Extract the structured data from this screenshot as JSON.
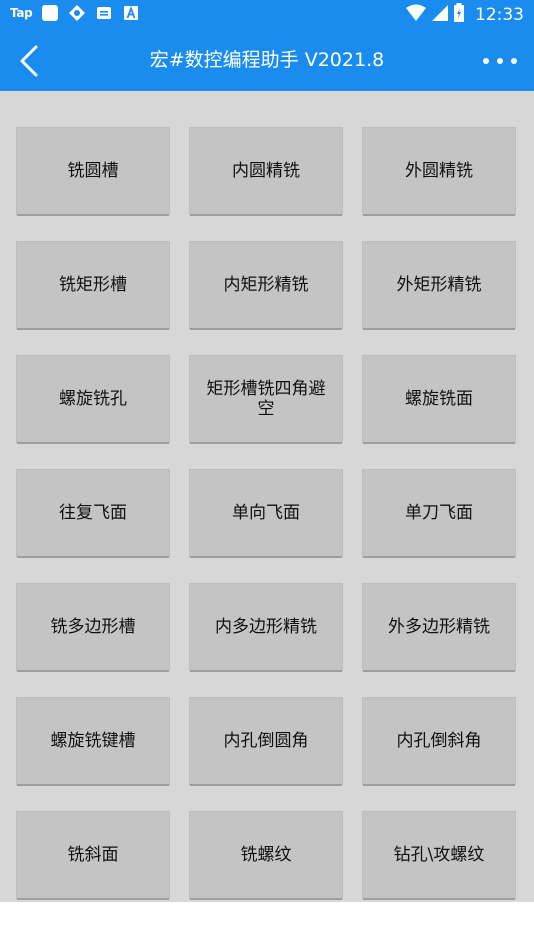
{
  "status_bar": {
    "tap_label": "Tap",
    "time": "12:33",
    "color": "#1a8cf0"
  },
  "app_bar": {
    "title": "宏#数控编程助手 V2021.8",
    "back_icon": "chevron-left-icon",
    "more_icon": "more-horizontal-icon"
  },
  "tools": [
    "铣圆槽",
    "内圆精铣",
    "外圆精铣",
    "铣矩形槽",
    "内矩形精铣",
    "外矩形精铣",
    "螺旋铣孔",
    "矩形槽铣四角避空",
    "螺旋铣面",
    "往复飞面",
    "单向飞面",
    "单刀飞面",
    "铣多边形槽",
    "内多边形精铣",
    "外多边形精铣",
    "螺旋铣键槽",
    "内孔倒圆角",
    "内孔倒斜角",
    "铣斜面",
    "铣螺纹",
    "钻孔\\攻螺纹"
  ]
}
